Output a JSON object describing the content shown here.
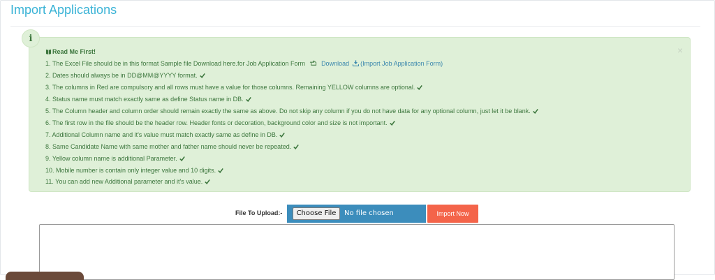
{
  "page": {
    "title": "Import Applications"
  },
  "alert": {
    "info_symbol": "i",
    "close_symbol": "×",
    "heading": "Read Me First!",
    "line1_text": "1. The Excel File should be in this format Sample file Download here.for Job Application Form",
    "download_label": "Download",
    "download_suffix": "(Import Job Application Form)",
    "lines": [
      "2. Dates should always be in DD@MM@YYYY format.",
      "3. The columns in Red are compulsory and all rows must have a value for those columns. Remaining YELLOW columns are optional.",
      "4. Status name must match exactly same as define Status name in DB.",
      "5. The Column header and column order should remain exactly the same as above. Do not skip any column if you do not have data for any optional column, just let it be blank.",
      "6. The first row in the file should be the header row. Header fonts or decoration, background color and size is not important.",
      "7. Additional Column name and it's value must match exactly same as define in DB.",
      "8. Same Candidate Name with same mother and father name should never be repeated.",
      "9. Yellow column name is additional Parameter.",
      "10. Mobile number is contain only integer value and 10 digits.",
      "11. You can add new Additional parameter and it's value."
    ],
    "icons": {
      "heading": "book-icon",
      "pointer": "hand-pointer-icon",
      "download": "download-icon",
      "line_end": "check-icon"
    },
    "colors": {
      "background": "#dff0d8",
      "text": "#3c763d",
      "link": "#3a87ad"
    }
  },
  "upload": {
    "label": "File To Upload:-",
    "choose_label": "Choose File",
    "no_file_text": "No file chosen",
    "import_label": "Import Now",
    "colors": {
      "file_input": "#3c8dbc",
      "import_button": "#f4644a"
    }
  },
  "theme": {
    "title_color": "#3ab3d6"
  }
}
